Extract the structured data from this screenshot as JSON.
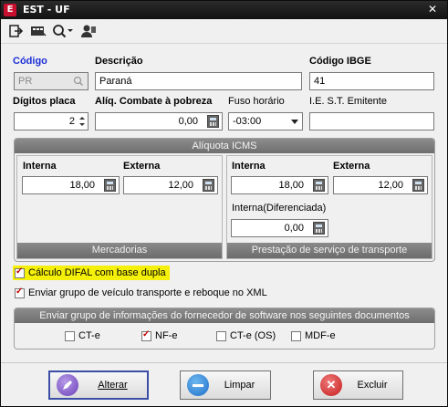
{
  "window": {
    "title": "EST - UF",
    "app_icon": "E"
  },
  "toolbar": {
    "icons": [
      "exit-icon",
      "record-icon",
      "search-icon",
      "user-icon"
    ]
  },
  "fields": {
    "codigo": {
      "label": "Código",
      "value": "PR"
    },
    "descricao": {
      "label": "Descrição",
      "value": "Paraná"
    },
    "codigo_ibge": {
      "label": "Código IBGE",
      "value": "41"
    },
    "digitos_placa": {
      "label": "Dígitos placa",
      "value": "2"
    },
    "aliq_combate": {
      "label": "Alíq. Combate à pobreza",
      "value": "0,00"
    },
    "fuso_horario": {
      "label": "Fuso horário",
      "value": "-03:00"
    },
    "ie_st": {
      "label": "I.E. S.T.  Emitente",
      "value": ""
    }
  },
  "aliquota_icms": {
    "title": "Alíquota ICMS",
    "mercadorias": {
      "footer": "Mercadorias",
      "interna_label": "Interna",
      "interna_value": "18,00",
      "externa_label": "Externa",
      "externa_value": "12,00"
    },
    "transporte": {
      "footer": "Prestação de serviço de transporte",
      "interna_label": "Interna",
      "interna_value": "18,00",
      "externa_label": "Externa",
      "externa_value": "12,00",
      "diferenciada_label": "Interna(Diferenciada)",
      "diferenciada_value": "0,00"
    }
  },
  "checkboxes": {
    "difal": {
      "label": "Cálculo DIFAL com base dupla",
      "checked": true,
      "highlight": "#f5f00a"
    },
    "veiculo": {
      "label": "Enviar grupo de veículo transporte e reboque no XML",
      "checked": true
    }
  },
  "docs_group": {
    "title": "Enviar grupo de informações do fornecedor de software nos seguintes documentos",
    "items": [
      {
        "label": "CT-e",
        "checked": false
      },
      {
        "label": "NF-e",
        "checked": true
      },
      {
        "label": "CT-e (OS)",
        "checked": false
      },
      {
        "label": "MDF-e",
        "checked": false
      }
    ]
  },
  "buttons": {
    "alterar": "Alterar",
    "limpar": "Limpar",
    "excluir": "Excluir"
  },
  "colors": {
    "accent_blue": "#1c2fd6",
    "highlight": "#f5f00a",
    "check_red": "#c00000"
  }
}
